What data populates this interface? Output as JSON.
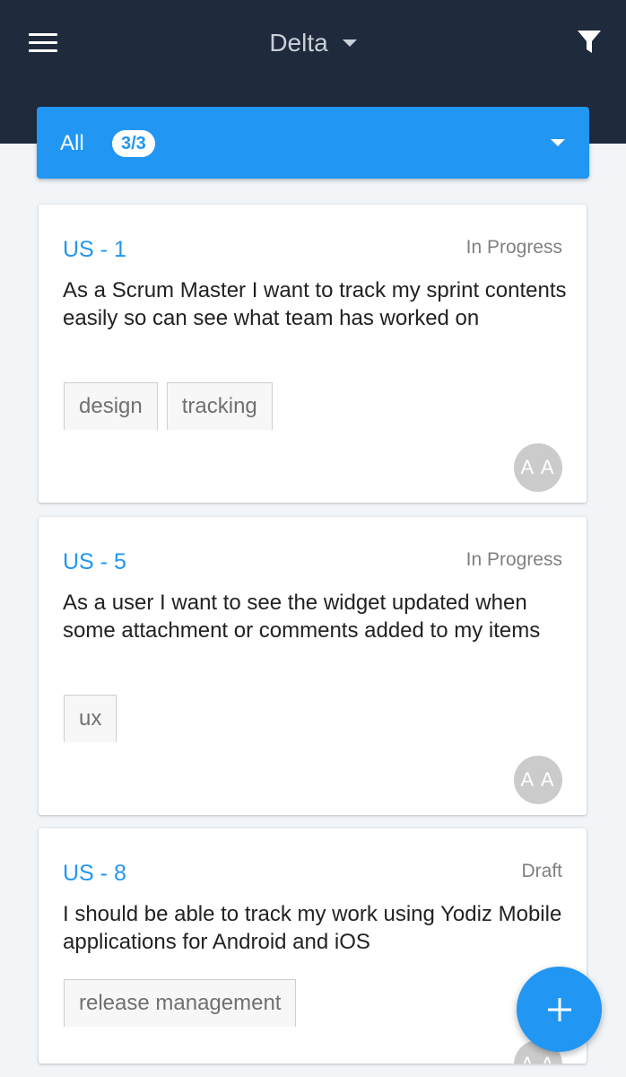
{
  "header": {
    "project_name": "Delta",
    "menu_icon": "hamburger-menu-icon",
    "filter_icon": "funnel-filter-icon",
    "background_color": "#1f2a3c"
  },
  "filter_bar": {
    "label": "All",
    "count": "3/3",
    "accent_color": "#2196f3"
  },
  "cards": [
    {
      "id": "US - 1",
      "status": "In Progress",
      "title": "As a Scrum Master I want to track my sprint contents easily so can see what team has worked on",
      "tags": [
        "design",
        "tracking"
      ],
      "assignee_initials": "A A"
    },
    {
      "id": "US - 5",
      "status": "In Progress",
      "title": "As a user I want to see the widget updated when some attachment or comments added to my items",
      "tags": [
        "ux"
      ],
      "assignee_initials": "A A"
    },
    {
      "id": "US - 8",
      "status": "Draft",
      "title": "I should be able to track my work using Yodiz Mobile applications for Android and iOS",
      "tags": [
        "release management"
      ],
      "assignee_initials": "A A"
    }
  ],
  "fab": {
    "icon": "plus-icon"
  }
}
